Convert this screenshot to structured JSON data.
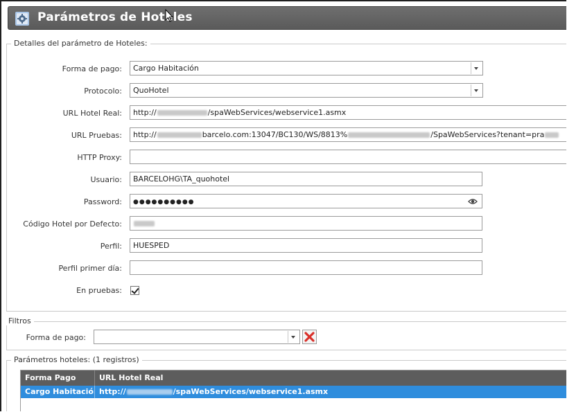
{
  "window": {
    "title": "Parámetros de Hoteles",
    "icon": "settings-gear-icon"
  },
  "details": {
    "legend": "Detalles del parámetro de Hoteles:",
    "fields": {
      "forma_pago": {
        "label": "Forma de pago:",
        "value": "Cargo Habitación"
      },
      "protocolo": {
        "label": "Protocolo:",
        "value": "QuoHotel"
      },
      "url_real": {
        "label": "URL Hotel Real:",
        "prefix": "http://",
        "suffix": "/spaWebServices/webservice1.asmx"
      },
      "url_pruebas": {
        "label": "URL Pruebas:",
        "prefix": "http://",
        "mid": "barcelo.com:13047/BC130/WS/8813%",
        "suffix": "/SpaWebServices?tenant=pra"
      },
      "http_proxy": {
        "label": "HTTP Proxy:",
        "value": ""
      },
      "usuario": {
        "label": "Usuario:",
        "value": "BARCELOHG\\TA_quohotel"
      },
      "password": {
        "label": "Password:",
        "value": "●●●●●●●●●●"
      },
      "codigo_hotel": {
        "label": "Código Hotel por Defecto:"
      },
      "perfil": {
        "label": "Perfil:",
        "value": "HUESPED"
      },
      "perfil_primer_dia": {
        "label": "Perfil primer día:",
        "value": ""
      },
      "en_pruebas": {
        "label": "En pruebas:",
        "checked": true
      }
    }
  },
  "filters": {
    "legend": "Filtros",
    "forma_pago_label": "Forma de pago:",
    "forma_pago_value": ""
  },
  "results": {
    "legend": "Parámetros hoteles:  (1 registros)",
    "columns": [
      "Forma Pago",
      "URL Hotel Real"
    ],
    "rows": [
      {
        "forma_pago": "Cargo Habitación",
        "url_prefix": "http://",
        "url_suffix": "/spaWebServices/webservice1.asmx"
      }
    ]
  },
  "colors": {
    "title_bar": "#5f5f5f",
    "grid_header": "#5d5d5d",
    "selected_row": "#2f8ddd",
    "clear_icon": "#d9302a"
  }
}
